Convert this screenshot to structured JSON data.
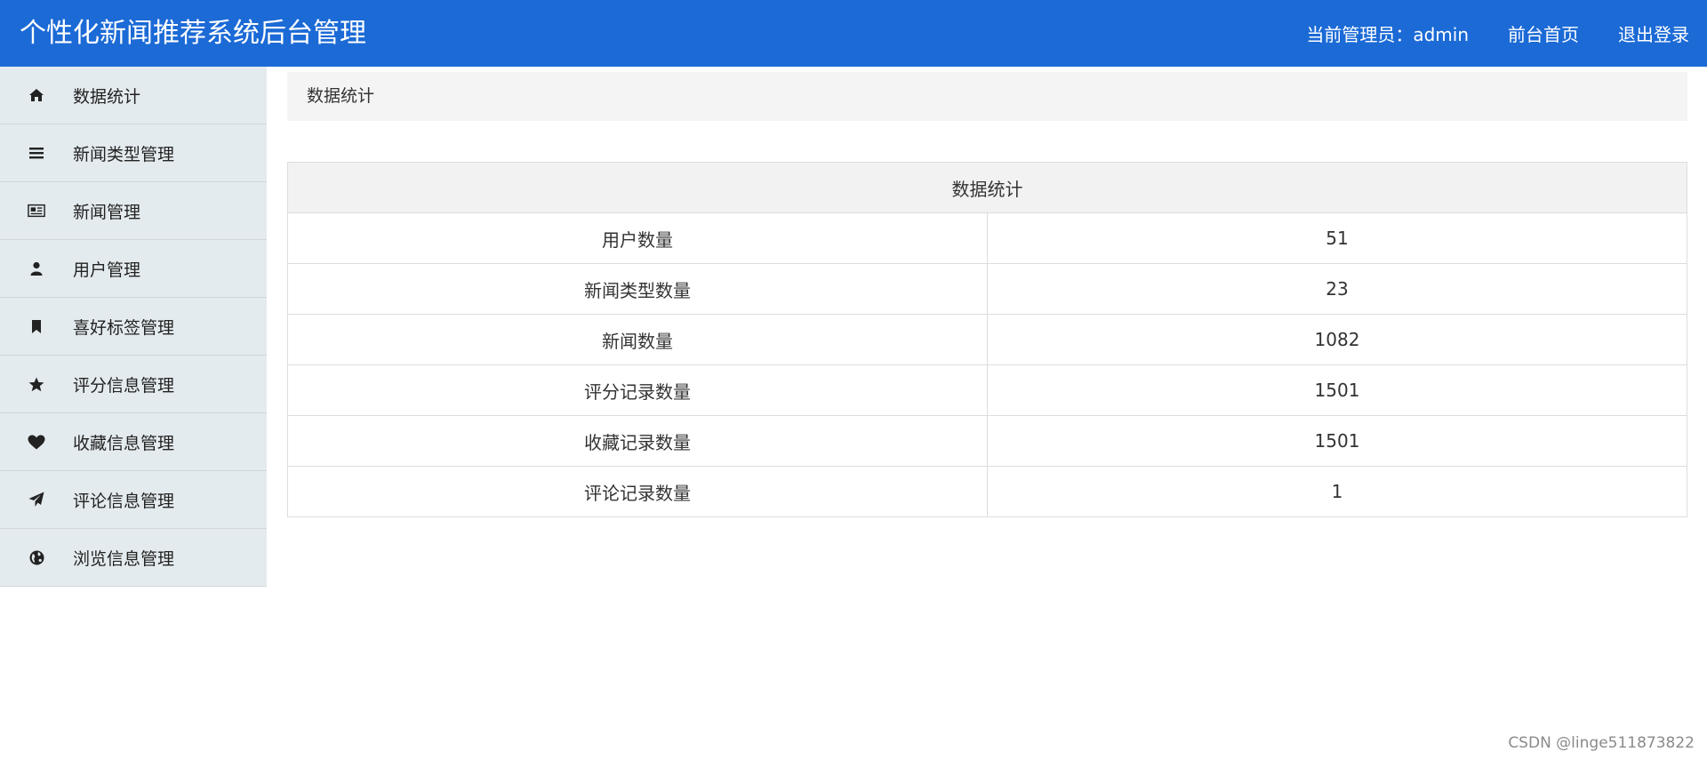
{
  "header": {
    "title": "个性化新闻推荐系统后台管理",
    "admin_label": "当前管理员：admin",
    "home_link": "前台首页",
    "logout_link": "退出登录"
  },
  "sidebar": {
    "items": [
      {
        "label": "数据统计",
        "icon": "home-icon"
      },
      {
        "label": "新闻类型管理",
        "icon": "list-icon"
      },
      {
        "label": "新闻管理",
        "icon": "newspaper-icon"
      },
      {
        "label": "用户管理",
        "icon": "user-icon"
      },
      {
        "label": "喜好标签管理",
        "icon": "bookmark-icon"
      },
      {
        "label": "评分信息管理",
        "icon": "star-icon"
      },
      {
        "label": "收藏信息管理",
        "icon": "heart-icon"
      },
      {
        "label": "评论信息管理",
        "icon": "paper-plane-icon"
      },
      {
        "label": "浏览信息管理",
        "icon": "globe-icon"
      }
    ]
  },
  "main": {
    "breadcrumb": "数据统计",
    "table": {
      "header": "数据统计",
      "rows": [
        {
          "label": "用户数量",
          "value": "51"
        },
        {
          "label": "新闻类型数量",
          "value": "23"
        },
        {
          "label": "新闻数量",
          "value": "1082"
        },
        {
          "label": "评分记录数量",
          "value": "1501"
        },
        {
          "label": "收藏记录数量",
          "value": "1501"
        },
        {
          "label": "评论记录数量",
          "value": "1"
        }
      ]
    }
  },
  "watermark": "CSDN @linge511873822",
  "colors": {
    "header_bg": "#1b6ad6",
    "sidebar_bg": "#e4ebee"
  }
}
